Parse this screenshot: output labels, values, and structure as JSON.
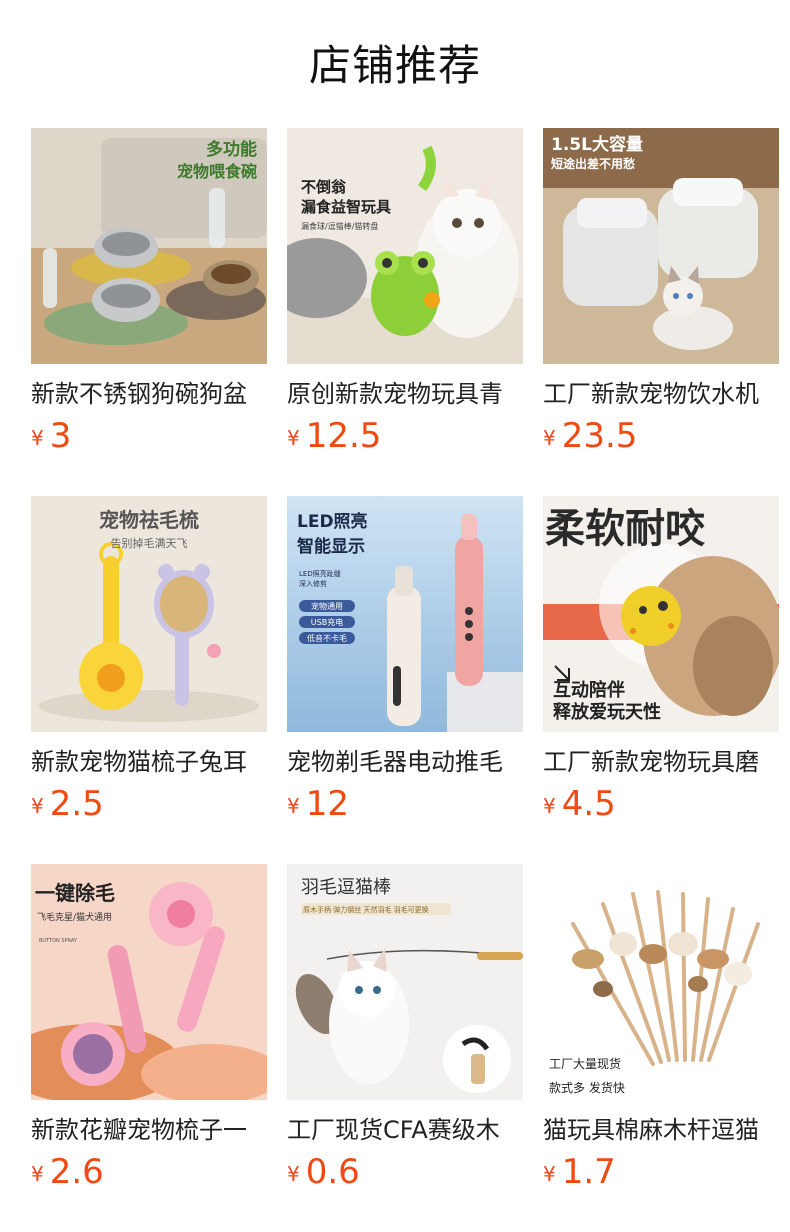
{
  "page": {
    "title": "店铺推荐"
  },
  "colors": {
    "price": "#ee4a12",
    "title": "#111111",
    "name": "#222222"
  },
  "products": [
    {
      "name": "新款不锈钢狗碗狗盆",
      "currency": "¥",
      "price": "3",
      "image_text": [
        "多功能",
        "宠物喂食碗"
      ],
      "icon": "pet-bowl-image"
    },
    {
      "name": "原创新款宠物玩具青",
      "currency": "¥",
      "price": "12.5",
      "image_text": [
        "不倒翁",
        "漏食益智玩具",
        "漏食球/逗猫棒/猫转盘"
      ],
      "icon": "tumbler-toy-image"
    },
    {
      "name": "工厂新款宠物饮水机",
      "currency": "¥",
      "price": "23.5",
      "image_text": [
        "1.5L大容量",
        "短途出差不用愁"
      ],
      "icon": "water-fountain-image"
    },
    {
      "name": "新款宠物猫梳子兔耳",
      "currency": "¥",
      "price": "2.5",
      "image_text": [
        "宠物祛毛梳",
        "告别掉毛满天飞"
      ],
      "icon": "pet-comb-image"
    },
    {
      "name": "宠物剃毛器电动推毛",
      "currency": "¥",
      "price": "12",
      "image_text": [
        "LED照亮",
        "智能显示",
        "LED照亮趾缝",
        "深入修剪",
        "宠物通用",
        "USB充电",
        "低音不卡毛"
      ],
      "icon": "pet-trimmer-image"
    },
    {
      "name": "工厂新款宠物玩具磨",
      "currency": "¥",
      "price": "4.5",
      "image_text": [
        "柔软耐咬",
        "互动陪伴",
        "释放爱玩天性"
      ],
      "icon": "chew-toy-image"
    },
    {
      "name": "新款花瓣宠物梳子一",
      "currency": "¥",
      "price": "2.6",
      "image_text": [
        "一键除毛",
        "飞毛克星/猫犬通用",
        "BUTTON SPRAY"
      ],
      "icon": "petal-comb-image"
    },
    {
      "name": "工厂现货CFA赛级木",
      "currency": "¥",
      "price": "0.6",
      "image_text": [
        "羽毛逗猫棒",
        "原木手柄 弹力钢丝 天然羽毛 羽毛可更换"
      ],
      "icon": "feather-wand-image"
    },
    {
      "name": "猫玩具棉麻木杆逗猫",
      "currency": "¥",
      "price": "1.7",
      "image_text": [
        "工厂大量现货",
        "款式多 发货快"
      ],
      "icon": "cat-teaser-sticks-image"
    }
  ]
}
